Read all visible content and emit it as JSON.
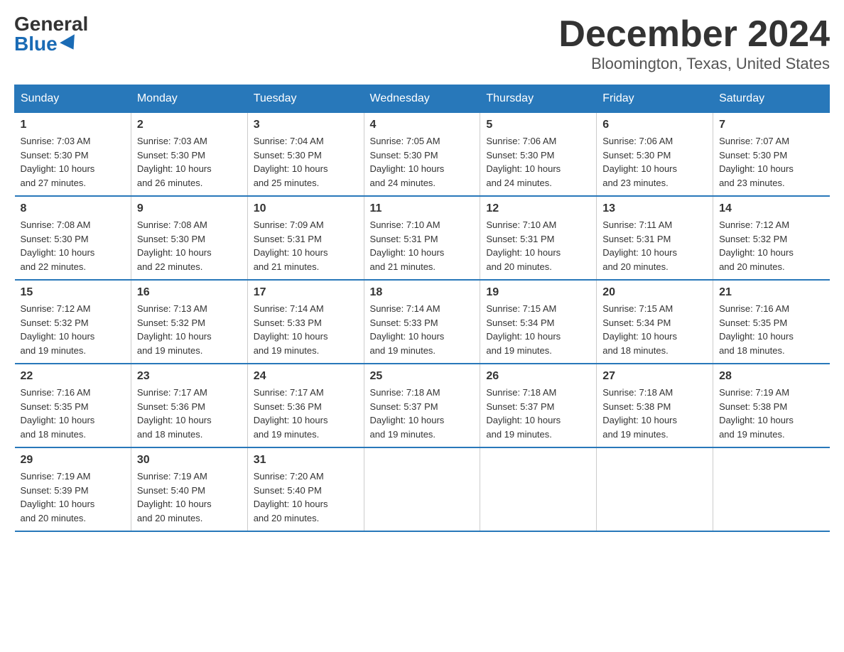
{
  "logo": {
    "general": "General",
    "blue": "Blue"
  },
  "title": "December 2024",
  "location": "Bloomington, Texas, United States",
  "days_of_week": [
    "Sunday",
    "Monday",
    "Tuesday",
    "Wednesday",
    "Thursday",
    "Friday",
    "Saturday"
  ],
  "weeks": [
    [
      {
        "day": "1",
        "sunrise": "7:03 AM",
        "sunset": "5:30 PM",
        "daylight": "10 hours and 27 minutes."
      },
      {
        "day": "2",
        "sunrise": "7:03 AM",
        "sunset": "5:30 PM",
        "daylight": "10 hours and 26 minutes."
      },
      {
        "day": "3",
        "sunrise": "7:04 AM",
        "sunset": "5:30 PM",
        "daylight": "10 hours and 25 minutes."
      },
      {
        "day": "4",
        "sunrise": "7:05 AM",
        "sunset": "5:30 PM",
        "daylight": "10 hours and 24 minutes."
      },
      {
        "day": "5",
        "sunrise": "7:06 AM",
        "sunset": "5:30 PM",
        "daylight": "10 hours and 24 minutes."
      },
      {
        "day": "6",
        "sunrise": "7:06 AM",
        "sunset": "5:30 PM",
        "daylight": "10 hours and 23 minutes."
      },
      {
        "day": "7",
        "sunrise": "7:07 AM",
        "sunset": "5:30 PM",
        "daylight": "10 hours and 23 minutes."
      }
    ],
    [
      {
        "day": "8",
        "sunrise": "7:08 AM",
        "sunset": "5:30 PM",
        "daylight": "10 hours and 22 minutes."
      },
      {
        "day": "9",
        "sunrise": "7:08 AM",
        "sunset": "5:30 PM",
        "daylight": "10 hours and 22 minutes."
      },
      {
        "day": "10",
        "sunrise": "7:09 AM",
        "sunset": "5:31 PM",
        "daylight": "10 hours and 21 minutes."
      },
      {
        "day": "11",
        "sunrise": "7:10 AM",
        "sunset": "5:31 PM",
        "daylight": "10 hours and 21 minutes."
      },
      {
        "day": "12",
        "sunrise": "7:10 AM",
        "sunset": "5:31 PM",
        "daylight": "10 hours and 20 minutes."
      },
      {
        "day": "13",
        "sunrise": "7:11 AM",
        "sunset": "5:31 PM",
        "daylight": "10 hours and 20 minutes."
      },
      {
        "day": "14",
        "sunrise": "7:12 AM",
        "sunset": "5:32 PM",
        "daylight": "10 hours and 20 minutes."
      }
    ],
    [
      {
        "day": "15",
        "sunrise": "7:12 AM",
        "sunset": "5:32 PM",
        "daylight": "10 hours and 19 minutes."
      },
      {
        "day": "16",
        "sunrise": "7:13 AM",
        "sunset": "5:32 PM",
        "daylight": "10 hours and 19 minutes."
      },
      {
        "day": "17",
        "sunrise": "7:14 AM",
        "sunset": "5:33 PM",
        "daylight": "10 hours and 19 minutes."
      },
      {
        "day": "18",
        "sunrise": "7:14 AM",
        "sunset": "5:33 PM",
        "daylight": "10 hours and 19 minutes."
      },
      {
        "day": "19",
        "sunrise": "7:15 AM",
        "sunset": "5:34 PM",
        "daylight": "10 hours and 19 minutes."
      },
      {
        "day": "20",
        "sunrise": "7:15 AM",
        "sunset": "5:34 PM",
        "daylight": "10 hours and 18 minutes."
      },
      {
        "day": "21",
        "sunrise": "7:16 AM",
        "sunset": "5:35 PM",
        "daylight": "10 hours and 18 minutes."
      }
    ],
    [
      {
        "day": "22",
        "sunrise": "7:16 AM",
        "sunset": "5:35 PM",
        "daylight": "10 hours and 18 minutes."
      },
      {
        "day": "23",
        "sunrise": "7:17 AM",
        "sunset": "5:36 PM",
        "daylight": "10 hours and 18 minutes."
      },
      {
        "day": "24",
        "sunrise": "7:17 AM",
        "sunset": "5:36 PM",
        "daylight": "10 hours and 19 minutes."
      },
      {
        "day": "25",
        "sunrise": "7:18 AM",
        "sunset": "5:37 PM",
        "daylight": "10 hours and 19 minutes."
      },
      {
        "day": "26",
        "sunrise": "7:18 AM",
        "sunset": "5:37 PM",
        "daylight": "10 hours and 19 minutes."
      },
      {
        "day": "27",
        "sunrise": "7:18 AM",
        "sunset": "5:38 PM",
        "daylight": "10 hours and 19 minutes."
      },
      {
        "day": "28",
        "sunrise": "7:19 AM",
        "sunset": "5:38 PM",
        "daylight": "10 hours and 19 minutes."
      }
    ],
    [
      {
        "day": "29",
        "sunrise": "7:19 AM",
        "sunset": "5:39 PM",
        "daylight": "10 hours and 20 minutes."
      },
      {
        "day": "30",
        "sunrise": "7:19 AM",
        "sunset": "5:40 PM",
        "daylight": "10 hours and 20 minutes."
      },
      {
        "day": "31",
        "sunrise": "7:20 AM",
        "sunset": "5:40 PM",
        "daylight": "10 hours and 20 minutes."
      },
      null,
      null,
      null,
      null
    ]
  ],
  "labels": {
    "sunrise": "Sunrise:",
    "sunset": "Sunset:",
    "daylight": "Daylight:"
  }
}
